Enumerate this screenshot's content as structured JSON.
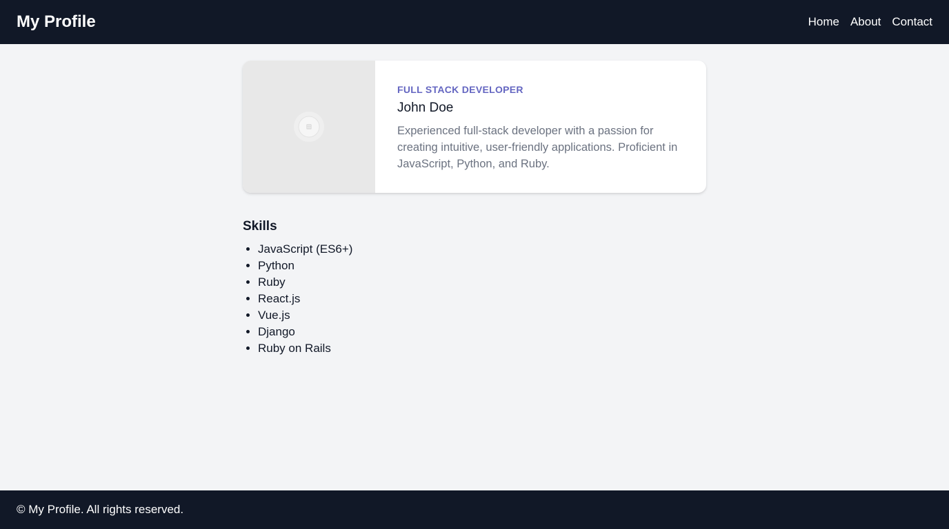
{
  "header": {
    "brand": "My Profile",
    "nav": [
      "Home",
      "About",
      "Contact"
    ]
  },
  "profile": {
    "image_icon": "image-placeholder-icon",
    "role": "Full Stack Developer",
    "name": "John Doe",
    "bio": "Experienced full-stack developer with a passion for creating intuitive, user-friendly applications. Proficient in JavaScript, Python, and Ruby."
  },
  "skills": {
    "title": "Skills",
    "items": [
      "JavaScript (ES6+)",
      "Python",
      "Ruby",
      "React.js",
      "Vue.js",
      "Django",
      "Ruby on Rails"
    ]
  },
  "footer": {
    "text": "© My Profile. All rights reserved."
  },
  "colors": {
    "header_bg": "#111827",
    "page_bg": "#f3f4f6",
    "accent": "#6466c1",
    "muted_text": "#6b7280"
  }
}
